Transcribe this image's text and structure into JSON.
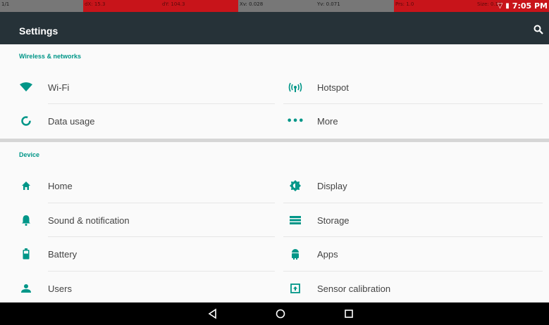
{
  "debug_bar": {
    "pointer": "1/1",
    "dx": "dX: 15.3",
    "dy": "dY: 104.3",
    "xv": "Xv: 0.028",
    "yv": "Yv: 0.071",
    "prs": "Prs: 1.0",
    "size": "Size: 0.10"
  },
  "status_bar": {
    "time": "7:05 PM"
  },
  "app_bar": {
    "title": "Settings"
  },
  "sections": [
    {
      "title": "Wireless & networks",
      "items": [
        {
          "label": "Wi-Fi",
          "icon": "wifi-icon"
        },
        {
          "label": "Hotspot",
          "icon": "hotspot-icon"
        },
        {
          "label": "Data usage",
          "icon": "data-usage-icon"
        },
        {
          "label": "More",
          "icon": "more-icon"
        }
      ]
    },
    {
      "title": "Device",
      "items": [
        {
          "label": "Home",
          "icon": "home-icon"
        },
        {
          "label": "Display",
          "icon": "display-icon"
        },
        {
          "label": "Sound & notification",
          "icon": "bell-icon"
        },
        {
          "label": "Storage",
          "icon": "storage-icon"
        },
        {
          "label": "Battery",
          "icon": "battery-icon"
        },
        {
          "label": "Apps",
          "icon": "android-icon"
        },
        {
          "label": "Users",
          "icon": "user-icon"
        },
        {
          "label": "Sensor calibration",
          "icon": "calibration-icon"
        }
      ]
    }
  ],
  "colors": {
    "accent": "#009688",
    "appbar": "#263238",
    "background": "#fafafa"
  }
}
